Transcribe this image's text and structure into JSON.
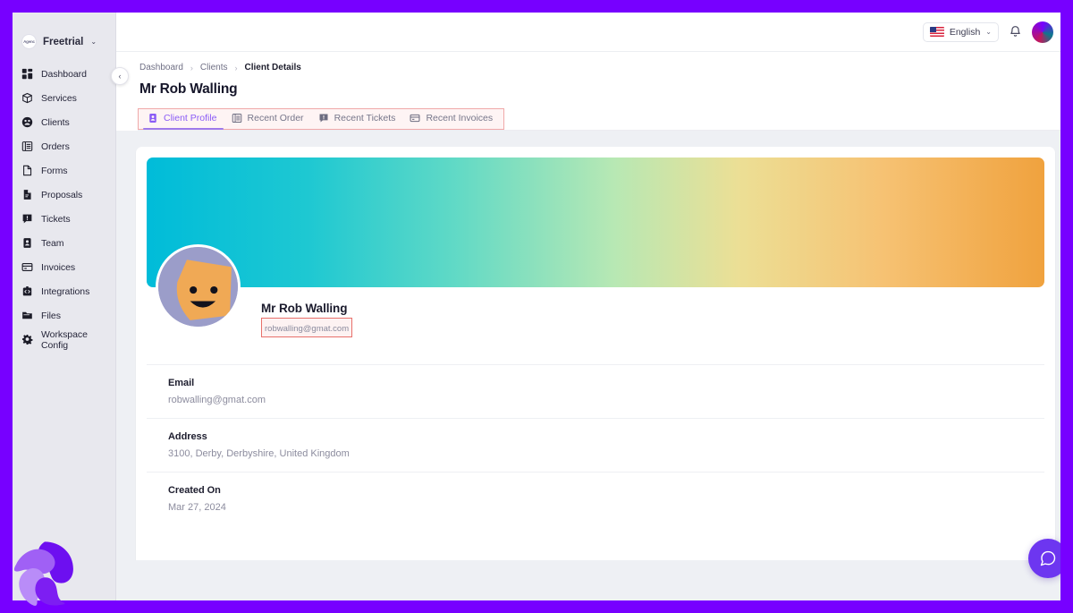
{
  "workspace": {
    "logo_text": "Agenc",
    "name": "Freetrial",
    "caret": "⌄"
  },
  "sidebar": {
    "items": [
      {
        "label": "Dashboard",
        "icon": "grid-icon"
      },
      {
        "label": "Services",
        "icon": "box-icon"
      },
      {
        "label": "Clients",
        "icon": "people-globe-icon"
      },
      {
        "label": "Orders",
        "icon": "table-icon"
      },
      {
        "label": "Forms",
        "icon": "document-icon"
      },
      {
        "label": "Proposals",
        "icon": "proposal-icon"
      },
      {
        "label": "Tickets",
        "icon": "ticket-icon"
      },
      {
        "label": "Team",
        "icon": "team-icon"
      },
      {
        "label": "Invoices",
        "icon": "invoice-card-icon"
      },
      {
        "label": "Integrations",
        "icon": "integrations-icon"
      },
      {
        "label": "Files",
        "icon": "folder-icon"
      },
      {
        "label": "Workspace Config",
        "icon": "gear-icon"
      }
    ],
    "collapse_icon": "‹"
  },
  "topbar": {
    "language": "English",
    "language_caret": "⌄",
    "flag_icon": "us-flag-icon",
    "bell_icon": "bell-icon",
    "avatar_icon": "user-avatar"
  },
  "breadcrumb": {
    "items": [
      "Dashboard",
      "Clients",
      "Client Details"
    ],
    "separator": "›"
  },
  "page": {
    "title": "Mr Rob Walling"
  },
  "tabs": [
    {
      "label": "Client Profile",
      "icon": "profile-card-icon",
      "active": true
    },
    {
      "label": "Recent Order",
      "icon": "table-icon",
      "active": false
    },
    {
      "label": "Recent Tickets",
      "icon": "ticket-icon",
      "active": false
    },
    {
      "label": "Recent Invoices",
      "icon": "invoice-card-icon",
      "active": false
    }
  ],
  "profile": {
    "name": "Mr Rob Walling",
    "email_badge": "robwalling@gmat.com",
    "avatar_icon": "smiley-face-avatar",
    "details": [
      {
        "label": "Email",
        "value": "robwalling@gmat.com"
      },
      {
        "label": "Address",
        "value": "3100, Derby, Derbyshire, United Kingdom"
      },
      {
        "label": "Created On",
        "value": "Mar 27, 2024"
      }
    ]
  },
  "chat": {
    "icon": "chat-bubble-icon"
  },
  "brand": {
    "icon": "pinwheel-logo"
  },
  "colors": {
    "frame_purple": "#7700ff",
    "accent_purple": "#8b5cf6",
    "highlight_red": "#e8706a",
    "banner_start": "#00bcd9",
    "banner_end": "#f0a23e",
    "avatar_bg": "#9b9dc9",
    "avatar_face": "#f0a955"
  }
}
